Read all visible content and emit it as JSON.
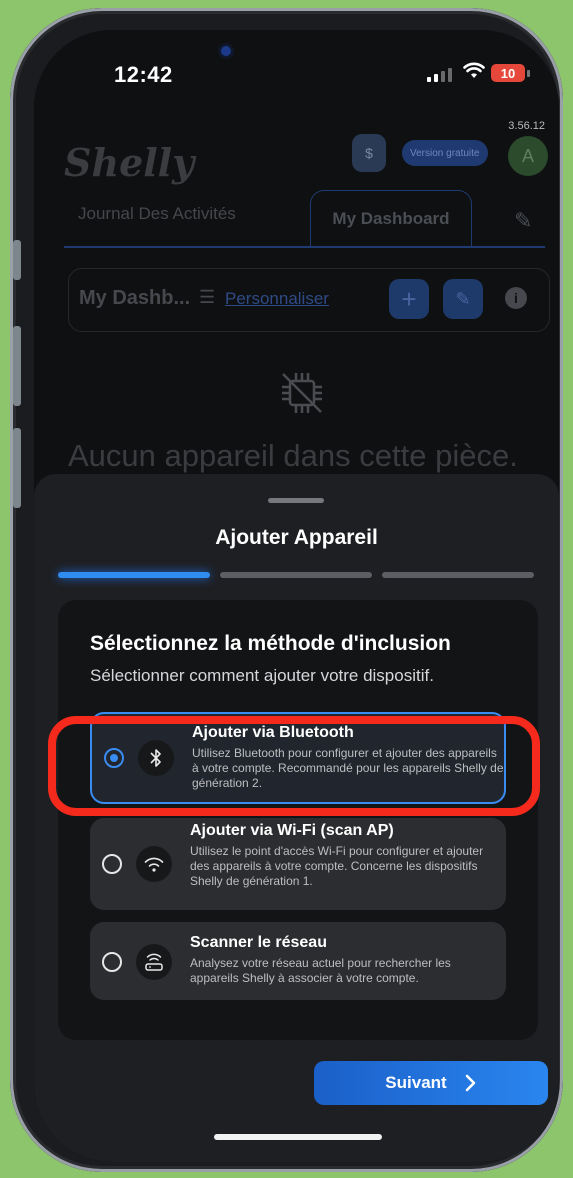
{
  "status_bar": {
    "time": "12:42",
    "battery": "10"
  },
  "background_app": {
    "version": "3.56.12",
    "logo": "Shelly",
    "free_badge": "Version gratuite",
    "avatar_initial": "A",
    "tabs": [
      "Journal Des Activités",
      "My Dashboard"
    ],
    "dashboard_title": "My Dashb...",
    "customize_label": "Personnaliser",
    "empty_message": "Aucun appareil dans cette pièce."
  },
  "sheet": {
    "title": "Ajouter Appareil",
    "progress_step": 1,
    "progress_total": 3,
    "heading": "Sélectionnez la méthode d'inclusion",
    "subheading": "Sélectionner comment ajouter votre dispositif.",
    "options": [
      {
        "title": "Ajouter via Bluetooth",
        "description": "Utilisez Bluetooth pour configurer et ajouter des appareils à votre compte. Recommandé pour les appareils Shelly de génération 2.",
        "icon": "bluetooth-icon",
        "selected": true
      },
      {
        "title": "Ajouter via Wi-Fi (scan AP)",
        "description": "Utilisez le point d'accès Wi-Fi pour configurer et ajouter des appareils à votre compte. Concerne les dispositifs Shelly de génération 1.",
        "icon": "wifi-icon",
        "selected": false
      },
      {
        "title": "Scanner le réseau",
        "description": "Analysez votre réseau actuel pour rechercher les appareils Shelly à associer à votre compte.",
        "icon": "router-icon",
        "selected": false
      }
    ],
    "next_label": "Suivant"
  },
  "colors": {
    "accent": "#2f8cf0",
    "highlight": "#f52a1c",
    "background": "#8cc56b"
  }
}
